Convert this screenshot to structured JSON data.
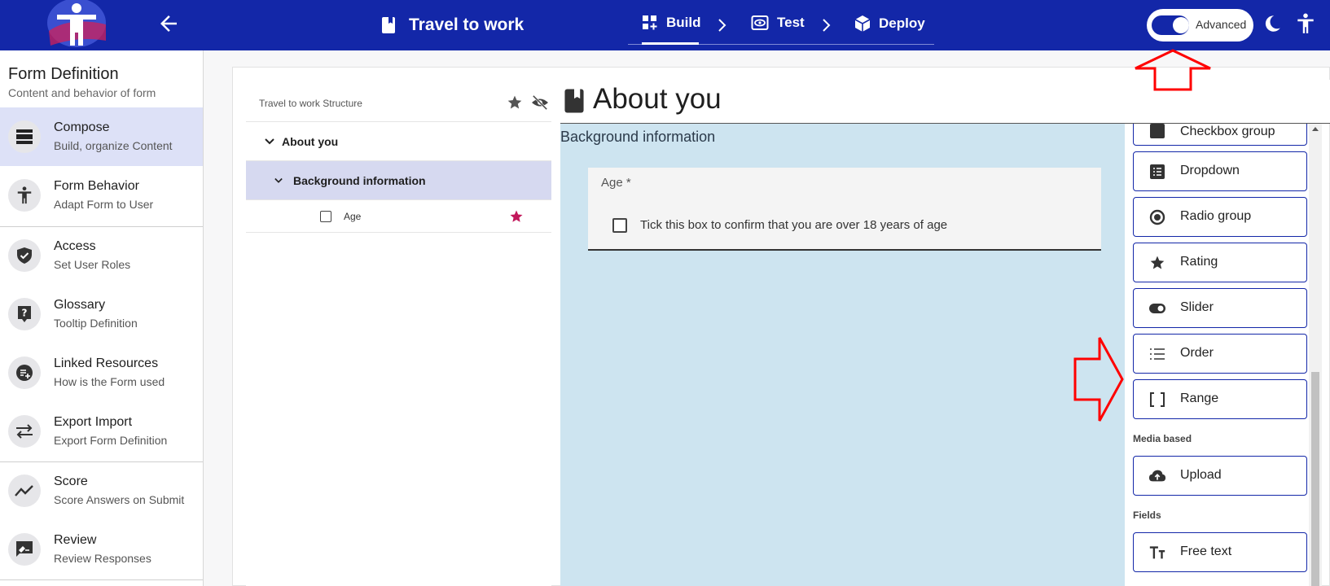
{
  "colors": {
    "primary": "#1327a8",
    "active_bg": "#dde1f7",
    "tree_selected": "#d6d9f0",
    "preview_bg": "#cde4f0",
    "star_accent": "#c2185b",
    "annotation": "#ff0000"
  },
  "header": {
    "form_title": "Travel to work",
    "steps": [
      {
        "label": "Build",
        "icon": "build-icon",
        "active": true
      },
      {
        "label": "Test",
        "icon": "eye-icon",
        "active": false
      },
      {
        "label": "Deploy",
        "icon": "cube-icon",
        "active": false
      }
    ],
    "advanced_label": "Advanced",
    "advanced_on": true
  },
  "sidebar": {
    "title": "Form Definition",
    "subtitle": "Content and behavior of form",
    "items": [
      {
        "label": "Compose",
        "sub": "Build, organize Content",
        "icon": "compose-icon",
        "active": true
      },
      {
        "label": "Form Behavior",
        "sub": "Adapt Form to User",
        "icon": "accessibility-icon",
        "active": false
      },
      {
        "label": "Access",
        "sub": "Set User Roles",
        "icon": "shield-icon",
        "active": false
      },
      {
        "label": "Glossary",
        "sub": "Tooltip Definition",
        "icon": "help-icon",
        "active": false
      },
      {
        "label": "Linked Resources",
        "sub": "How is the Form used",
        "icon": "playlist-add-icon",
        "active": false
      },
      {
        "label": "Export Import",
        "sub": "Export Form Definition",
        "icon": "swap-icon",
        "active": false
      },
      {
        "label": "Score",
        "sub": "Score Answers on Submit",
        "icon": "chart-icon",
        "active": false
      },
      {
        "label": "Review",
        "sub": "Review Responses",
        "icon": "rate-review-icon",
        "active": false
      }
    ]
  },
  "structure": {
    "title": "Travel to work Structure",
    "page": "About you",
    "section": "Background information",
    "question": "Age"
  },
  "preview": {
    "page_title": "About you",
    "section_title": "Background information",
    "question_label": "Age *",
    "checkbox_label": "Tick this box to confirm that you are over 18 years of age"
  },
  "toolbox": {
    "partial_top_label": "Checkbox group",
    "buttons_group1": [
      {
        "label": "Dropdown",
        "icon": "dropdown-icon"
      },
      {
        "label": "Radio group",
        "icon": "radio-icon"
      },
      {
        "label": "Rating",
        "icon": "star-icon"
      },
      {
        "label": "Slider",
        "icon": "toggle-icon"
      },
      {
        "label": "Order",
        "icon": "list-icon"
      },
      {
        "label": "Range",
        "icon": "bracket-icon"
      }
    ],
    "category_media": "Media based",
    "upload_label": "Upload",
    "category_fields": "Fields",
    "free_text_label": "Free text"
  }
}
